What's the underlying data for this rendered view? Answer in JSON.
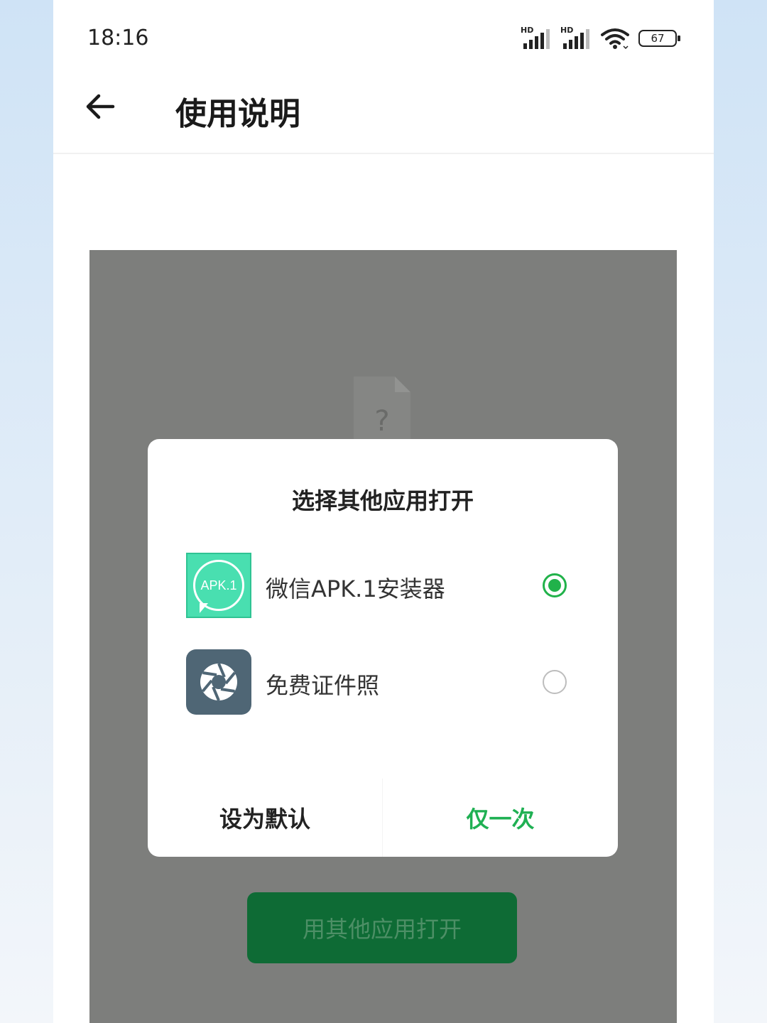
{
  "status_bar": {
    "time": "18:16",
    "sim1_label": "HD",
    "sim2_label": "HD",
    "battery_level": "67",
    "icons": [
      "signal-icon",
      "signal-icon",
      "wifi-icon",
      "battery-icon"
    ]
  },
  "app_bar": {
    "title": "使用说明",
    "back_icon": "back-arrow-icon"
  },
  "file_placeholder": {
    "symbol": "?"
  },
  "dialog": {
    "title": "选择其他应用打开",
    "options": [
      {
        "icon_text": "APK.1",
        "label": "微信APK.1安装器",
        "selected": true,
        "icon_color": "#49dfb0"
      },
      {
        "icon_name": "camera-aperture-icon",
        "label": "免费证件照",
        "selected": false,
        "icon_color": "#4f6675"
      }
    ],
    "set_default_label": "设为默认",
    "just_once_label": "仅一次"
  },
  "open_other_button": {
    "label": "用其他应用打开"
  },
  "colors": {
    "accent_green": "#1fb053",
    "button_green": "#0e6b35",
    "overlay_gray": "#7d7e7c"
  }
}
